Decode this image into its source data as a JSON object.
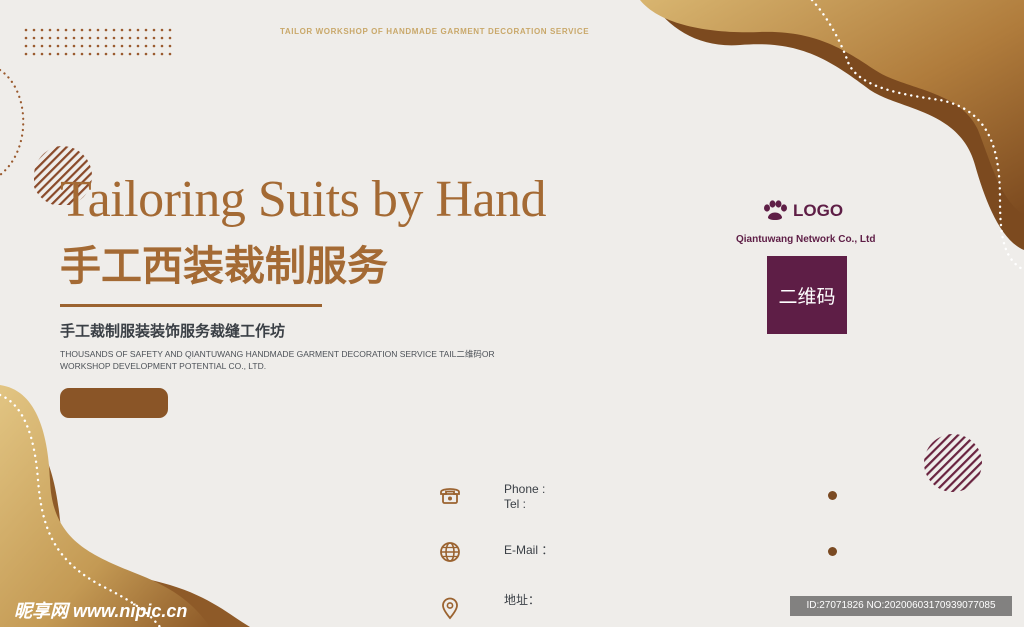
{
  "header": {
    "tagline": "TAILOR WORKSHOP OF HANDMADE GARMENT DECORATION SERVICE"
  },
  "hero": {
    "title_en": "Tailoring Suits by Hand",
    "title_cn": "手工西装裁制服务",
    "subtitle_cn": "手工裁制服装装饰服务裁缝工作坊",
    "description_line1": "THOUSANDS OF SAFETY AND QIANTUWANG HANDMADE GARMENT DECORATION SERVICE TAIL二维码OR",
    "description_line2": "WORKSHOP DEVELOPMENT POTENTIAL CO., LTD."
  },
  "brand": {
    "logo_text": "LOGO",
    "company": "Qiantuwang Network Co., Ltd",
    "qr_label": "二维码",
    "accent": "#5e1e46"
  },
  "contact": {
    "phone_label": "Phone :",
    "tel_label": "Tel :",
    "email_label": "E-Mail ：",
    "address_label": "地址："
  },
  "watermark": {
    "left_text": "昵享网 www.nipic.cn",
    "right_text": "ID:27071826 NO:20200603170939077085"
  },
  "colors": {
    "brown": "#a46a34",
    "gold": "#c9a86a",
    "dark_brown": "#8a5527",
    "background": "#efedea"
  }
}
